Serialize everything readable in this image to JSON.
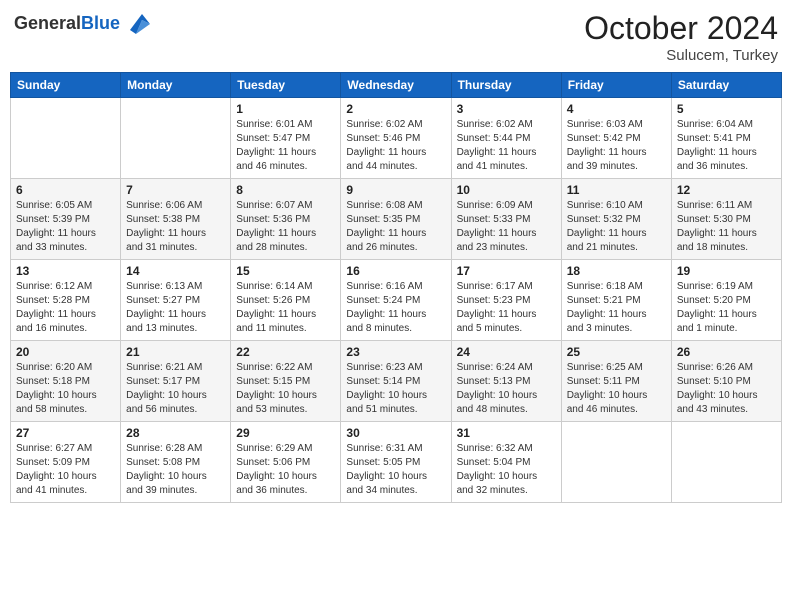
{
  "header": {
    "logo_general": "General",
    "logo_blue": "Blue",
    "month_title": "October 2024",
    "location": "Sulucem, Turkey"
  },
  "days_of_week": [
    "Sunday",
    "Monday",
    "Tuesday",
    "Wednesday",
    "Thursday",
    "Friday",
    "Saturday"
  ],
  "weeks": [
    [
      {
        "day": "",
        "sunrise": "",
        "sunset": "",
        "daylight": ""
      },
      {
        "day": "",
        "sunrise": "",
        "sunset": "",
        "daylight": ""
      },
      {
        "day": "1",
        "sunrise": "Sunrise: 6:01 AM",
        "sunset": "Sunset: 5:47 PM",
        "daylight": "Daylight: 11 hours and 46 minutes."
      },
      {
        "day": "2",
        "sunrise": "Sunrise: 6:02 AM",
        "sunset": "Sunset: 5:46 PM",
        "daylight": "Daylight: 11 hours and 44 minutes."
      },
      {
        "day": "3",
        "sunrise": "Sunrise: 6:02 AM",
        "sunset": "Sunset: 5:44 PM",
        "daylight": "Daylight: 11 hours and 41 minutes."
      },
      {
        "day": "4",
        "sunrise": "Sunrise: 6:03 AM",
        "sunset": "Sunset: 5:42 PM",
        "daylight": "Daylight: 11 hours and 39 minutes."
      },
      {
        "day": "5",
        "sunrise": "Sunrise: 6:04 AM",
        "sunset": "Sunset: 5:41 PM",
        "daylight": "Daylight: 11 hours and 36 minutes."
      }
    ],
    [
      {
        "day": "6",
        "sunrise": "Sunrise: 6:05 AM",
        "sunset": "Sunset: 5:39 PM",
        "daylight": "Daylight: 11 hours and 33 minutes."
      },
      {
        "day": "7",
        "sunrise": "Sunrise: 6:06 AM",
        "sunset": "Sunset: 5:38 PM",
        "daylight": "Daylight: 11 hours and 31 minutes."
      },
      {
        "day": "8",
        "sunrise": "Sunrise: 6:07 AM",
        "sunset": "Sunset: 5:36 PM",
        "daylight": "Daylight: 11 hours and 28 minutes."
      },
      {
        "day": "9",
        "sunrise": "Sunrise: 6:08 AM",
        "sunset": "Sunset: 5:35 PM",
        "daylight": "Daylight: 11 hours and 26 minutes."
      },
      {
        "day": "10",
        "sunrise": "Sunrise: 6:09 AM",
        "sunset": "Sunset: 5:33 PM",
        "daylight": "Daylight: 11 hours and 23 minutes."
      },
      {
        "day": "11",
        "sunrise": "Sunrise: 6:10 AM",
        "sunset": "Sunset: 5:32 PM",
        "daylight": "Daylight: 11 hours and 21 minutes."
      },
      {
        "day": "12",
        "sunrise": "Sunrise: 6:11 AM",
        "sunset": "Sunset: 5:30 PM",
        "daylight": "Daylight: 11 hours and 18 minutes."
      }
    ],
    [
      {
        "day": "13",
        "sunrise": "Sunrise: 6:12 AM",
        "sunset": "Sunset: 5:28 PM",
        "daylight": "Daylight: 11 hours and 16 minutes."
      },
      {
        "day": "14",
        "sunrise": "Sunrise: 6:13 AM",
        "sunset": "Sunset: 5:27 PM",
        "daylight": "Daylight: 11 hours and 13 minutes."
      },
      {
        "day": "15",
        "sunrise": "Sunrise: 6:14 AM",
        "sunset": "Sunset: 5:26 PM",
        "daylight": "Daylight: 11 hours and 11 minutes."
      },
      {
        "day": "16",
        "sunrise": "Sunrise: 6:16 AM",
        "sunset": "Sunset: 5:24 PM",
        "daylight": "Daylight: 11 hours and 8 minutes."
      },
      {
        "day": "17",
        "sunrise": "Sunrise: 6:17 AM",
        "sunset": "Sunset: 5:23 PM",
        "daylight": "Daylight: 11 hours and 5 minutes."
      },
      {
        "day": "18",
        "sunrise": "Sunrise: 6:18 AM",
        "sunset": "Sunset: 5:21 PM",
        "daylight": "Daylight: 11 hours and 3 minutes."
      },
      {
        "day": "19",
        "sunrise": "Sunrise: 6:19 AM",
        "sunset": "Sunset: 5:20 PM",
        "daylight": "Daylight: 11 hours and 1 minute."
      }
    ],
    [
      {
        "day": "20",
        "sunrise": "Sunrise: 6:20 AM",
        "sunset": "Sunset: 5:18 PM",
        "daylight": "Daylight: 10 hours and 58 minutes."
      },
      {
        "day": "21",
        "sunrise": "Sunrise: 6:21 AM",
        "sunset": "Sunset: 5:17 PM",
        "daylight": "Daylight: 10 hours and 56 minutes."
      },
      {
        "day": "22",
        "sunrise": "Sunrise: 6:22 AM",
        "sunset": "Sunset: 5:15 PM",
        "daylight": "Daylight: 10 hours and 53 minutes."
      },
      {
        "day": "23",
        "sunrise": "Sunrise: 6:23 AM",
        "sunset": "Sunset: 5:14 PM",
        "daylight": "Daylight: 10 hours and 51 minutes."
      },
      {
        "day": "24",
        "sunrise": "Sunrise: 6:24 AM",
        "sunset": "Sunset: 5:13 PM",
        "daylight": "Daylight: 10 hours and 48 minutes."
      },
      {
        "day": "25",
        "sunrise": "Sunrise: 6:25 AM",
        "sunset": "Sunset: 5:11 PM",
        "daylight": "Daylight: 10 hours and 46 minutes."
      },
      {
        "day": "26",
        "sunrise": "Sunrise: 6:26 AM",
        "sunset": "Sunset: 5:10 PM",
        "daylight": "Daylight: 10 hours and 43 minutes."
      }
    ],
    [
      {
        "day": "27",
        "sunrise": "Sunrise: 6:27 AM",
        "sunset": "Sunset: 5:09 PM",
        "daylight": "Daylight: 10 hours and 41 minutes."
      },
      {
        "day": "28",
        "sunrise": "Sunrise: 6:28 AM",
        "sunset": "Sunset: 5:08 PM",
        "daylight": "Daylight: 10 hours and 39 minutes."
      },
      {
        "day": "29",
        "sunrise": "Sunrise: 6:29 AM",
        "sunset": "Sunset: 5:06 PM",
        "daylight": "Daylight: 10 hours and 36 minutes."
      },
      {
        "day": "30",
        "sunrise": "Sunrise: 6:31 AM",
        "sunset": "Sunset: 5:05 PM",
        "daylight": "Daylight: 10 hours and 34 minutes."
      },
      {
        "day": "31",
        "sunrise": "Sunrise: 6:32 AM",
        "sunset": "Sunset: 5:04 PM",
        "daylight": "Daylight: 10 hours and 32 minutes."
      },
      {
        "day": "",
        "sunrise": "",
        "sunset": "",
        "daylight": ""
      },
      {
        "day": "",
        "sunrise": "",
        "sunset": "",
        "daylight": ""
      }
    ]
  ]
}
